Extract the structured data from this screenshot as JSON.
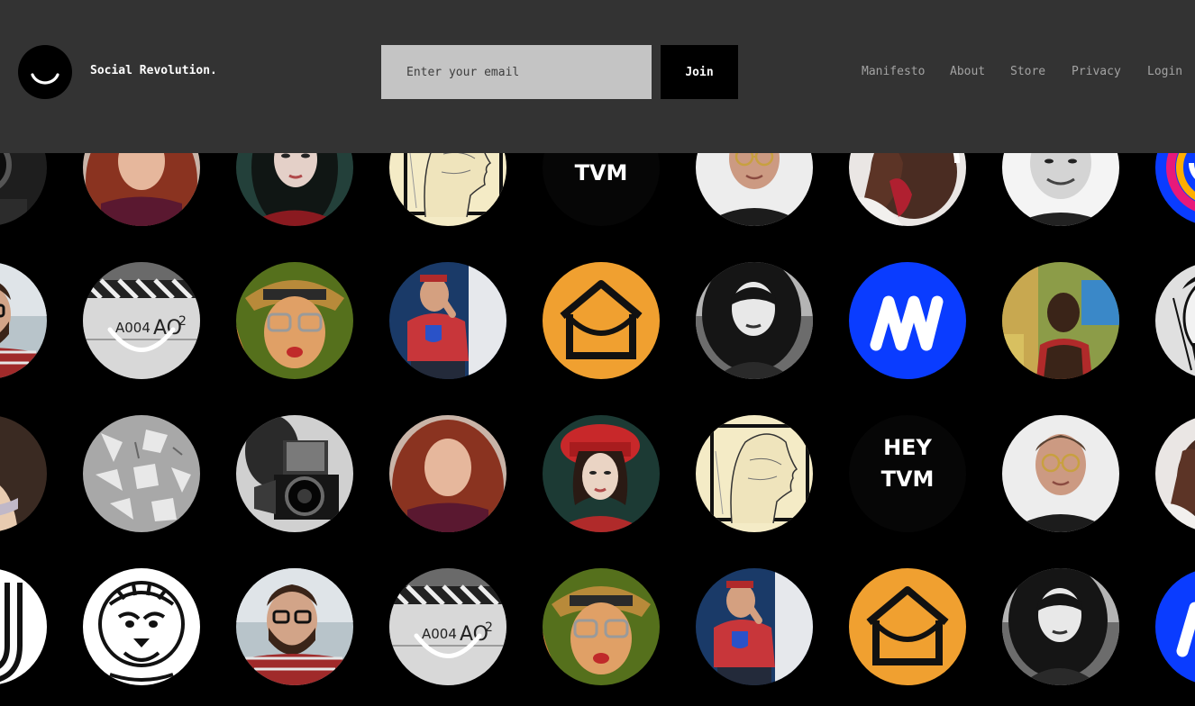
{
  "header": {
    "brand": "Social Revolution.",
    "email_placeholder": "Enter your email",
    "join_label": "Join",
    "nav": [
      "Manifesto",
      "About",
      "Store",
      "Privacy",
      "Login"
    ]
  },
  "colors": {
    "header_bg": "#333333",
    "page_bg": "#000000",
    "input_bg": "#c4c4c4",
    "nav_text": "#a3a3a3",
    "ello_blue": "#0a3cff",
    "hammock_orange": "#f0a030"
  },
  "avatar_text": {
    "hey": "HEY",
    "tvm": "TVM",
    "slate_roll": "A004",
    "slate_scene": "AO",
    "slate_take": "2"
  },
  "avatar_grid": [
    [
      "camera-dark",
      "red-hair-woman",
      "dark-hair-woman",
      "sketch-profile",
      "hey-tvm",
      "glasses-man",
      "hand-portrait",
      "smiling-man",
      "color-logo"
    ],
    [
      "glasses-beard-man",
      "film-slate",
      "cap-glasses-woman",
      "red-shirt-man",
      "hammock-logo",
      "bw-woman",
      "ello-logo",
      "man-red-tank",
      "comic-face"
    ],
    [
      "painting-nude",
      "gray-pattern",
      "bw-camera",
      "red-hair-woman",
      "red-hat-woman",
      "sketch-profile",
      "hey-tvm",
      "glasses-man",
      "hand-portrait"
    ],
    [
      "line-logo",
      "lion-face",
      "glasses-beard-man",
      "film-slate",
      "cap-glasses-woman",
      "red-shirt-man",
      "hammock-logo",
      "bw-woman",
      "ello-logo"
    ]
  ]
}
